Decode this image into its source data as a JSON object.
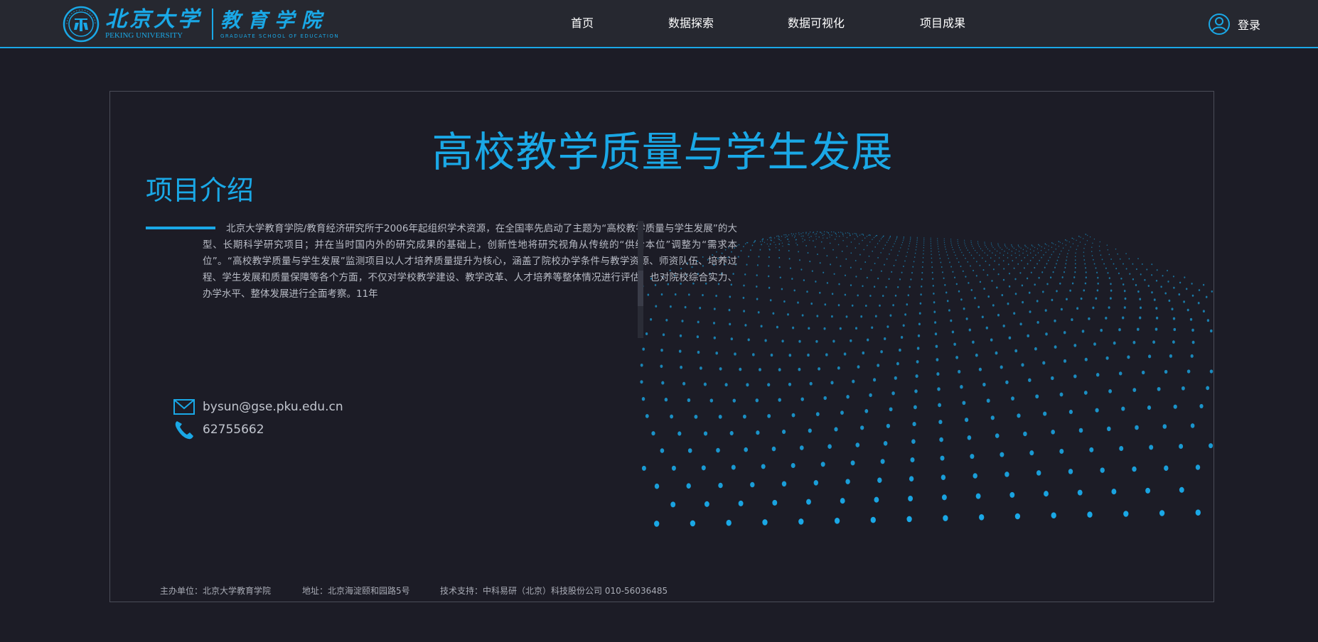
{
  "header": {
    "logo": {
      "pku_cn": "北京大学",
      "pku_en": "PEKING UNIVERSITY",
      "gse_cn": "教育学院",
      "gse_en": "GRADUATE SCHOOL OF EDUCATION",
      "seal_icon": "pku-seal-icon"
    },
    "nav": [
      {
        "label": "首页"
      },
      {
        "label": "数据探索"
      },
      {
        "label": "数据可视化"
      },
      {
        "label": "项目成果"
      }
    ],
    "login_label": "登录",
    "login_icon": "user-circle-icon"
  },
  "main": {
    "title": "高校教学质量与学生发展",
    "section_title": "项目介绍",
    "intro": "北京大学教育学院/教育经济研究所于2006年起组织学术资源，在全国率先启动了主题为“高校教学质量与学生发展”的大型、长期科学研究项目；并在当时国内外的研究成果的基础上，创新性地将研究视角从传统的“供给本位”调整为“需求本位”。“高校教学质量与学生发展”监测项目以人才培养质量提升为核心，涵盖了院校办学条件与教学资源、师资队伍、培养过程、学生发展和质量保障等各个方面，不仅对学校教学建设、教学改革、人才培养等整体情况进行评估，也对院校综合实力、办学水平、整体发展进行全面考察。11年",
    "contact": {
      "email": "bysun@gse.pku.edu.cn",
      "email_icon": "envelope-icon",
      "phone": "62755662",
      "phone_icon": "phone-icon"
    }
  },
  "footer": {
    "host": "主办单位：北京大学教育学院",
    "address": "地址：北京海淀颐和园路5号",
    "support": "技术支持：中科易研（北京）科技股份公司 010-56036485"
  },
  "colors": {
    "accent": "#1aa8e6",
    "background": "#1c1c26",
    "header": "#262830"
  }
}
